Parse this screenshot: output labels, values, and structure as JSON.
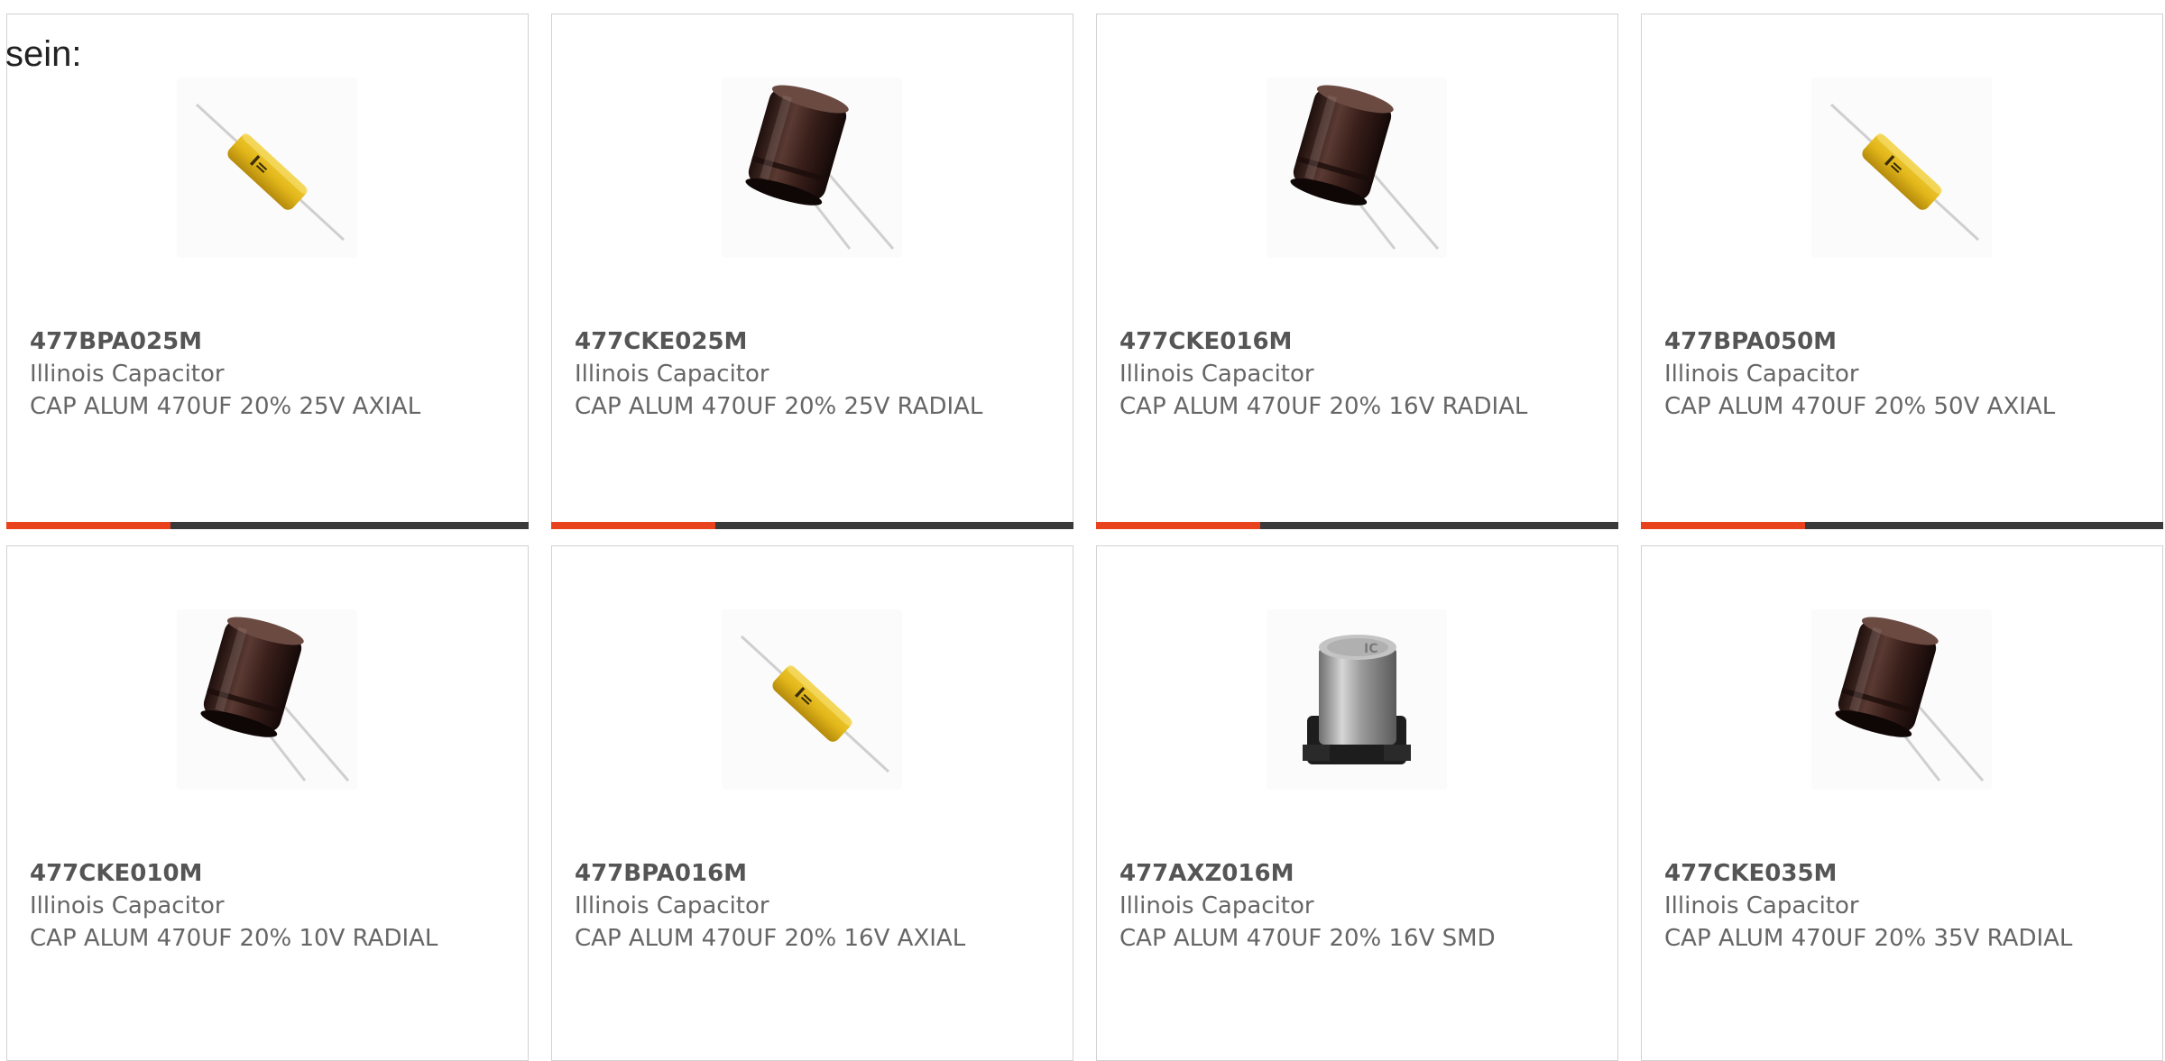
{
  "intro_text": "sein:",
  "colors": {
    "accent": "#e8431d",
    "bar": "#3a3a3a",
    "border": "#d2d2d2",
    "text": "#666666"
  },
  "products": [
    {
      "part_number": "477BPA025M",
      "manufacturer": "Illinois Capacitor",
      "description": "CAP ALUM 470UF 20% 25V AXIAL",
      "image": "axial-capacitor-yellow"
    },
    {
      "part_number": "477CKE025M",
      "manufacturer": "Illinois Capacitor",
      "description": "CAP ALUM 470UF 20% 25V RADIAL",
      "image": "radial-capacitor-brown"
    },
    {
      "part_number": "477CKE016M",
      "manufacturer": "Illinois Capacitor",
      "description": "CAP ALUM 470UF 20% 16V RADIAL",
      "image": "radial-capacitor-brown"
    },
    {
      "part_number": "477BPA050M",
      "manufacturer": "Illinois Capacitor",
      "description": "CAP ALUM 470UF 20% 50V AXIAL",
      "image": "axial-capacitor-yellow"
    },
    {
      "part_number": "477CKE010M",
      "manufacturer": "Illinois Capacitor",
      "description": "CAP ALUM 470UF 20% 10V RADIAL",
      "image": "radial-capacitor-brown"
    },
    {
      "part_number": "477BPA016M",
      "manufacturer": "Illinois Capacitor",
      "description": "CAP ALUM 470UF 20% 16V AXIAL",
      "image": "axial-capacitor-yellow"
    },
    {
      "part_number": "477AXZ016M",
      "manufacturer": "Illinois Capacitor",
      "description": "CAP ALUM 470UF 20% 16V SMD",
      "image": "smd-capacitor-silver"
    },
    {
      "part_number": "477CKE035M",
      "manufacturer": "Illinois Capacitor",
      "description": "CAP ALUM 470UF 20% 35V RADIAL",
      "image": "radial-capacitor-brown"
    }
  ]
}
